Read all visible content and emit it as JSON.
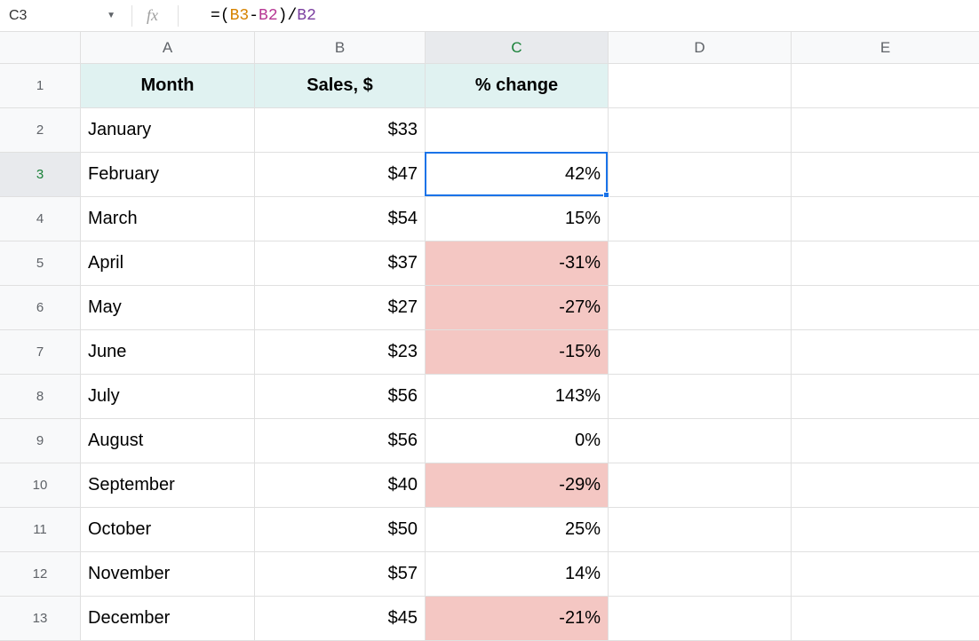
{
  "formula_bar": {
    "cell_ref": "C3",
    "fx_label": "fx",
    "formula": {
      "eq": "=",
      "open": "(",
      "ref_a": "B3",
      "minus": "-",
      "ref_b": "B2",
      "close": ")",
      "slash": "/",
      "ref_c": "B2"
    }
  },
  "columns": [
    "A",
    "B",
    "C",
    "D",
    "E"
  ],
  "row_labels": [
    "1",
    "2",
    "3",
    "4",
    "5",
    "6",
    "7",
    "8",
    "9",
    "10",
    "11",
    "12",
    "13"
  ],
  "selected_cell": {
    "col": "C",
    "row": "3"
  },
  "headers": {
    "month": "Month",
    "sales": "Sales, $",
    "change": "% change"
  },
  "rows": [
    {
      "month": "January",
      "sales": "$33",
      "change": "",
      "neg": false
    },
    {
      "month": "February",
      "sales": "$47",
      "change": "42%",
      "neg": false
    },
    {
      "month": "March",
      "sales": "$54",
      "change": "15%",
      "neg": false
    },
    {
      "month": "April",
      "sales": "$37",
      "change": "-31%",
      "neg": true
    },
    {
      "month": "May",
      "sales": "$27",
      "change": "-27%",
      "neg": true
    },
    {
      "month": "June",
      "sales": "$23",
      "change": "-15%",
      "neg": true
    },
    {
      "month": "July",
      "sales": "$56",
      "change": "143%",
      "neg": false
    },
    {
      "month": "August",
      "sales": "$56",
      "change": "0%",
      "neg": false
    },
    {
      "month": "September",
      "sales": "$40",
      "change": "-29%",
      "neg": true
    },
    {
      "month": "October",
      "sales": "$50",
      "change": "25%",
      "neg": false
    },
    {
      "month": "November",
      "sales": "$57",
      "change": "14%",
      "neg": false
    },
    {
      "month": "December",
      "sales": "$45",
      "change": "-21%",
      "neg": true
    }
  ]
}
